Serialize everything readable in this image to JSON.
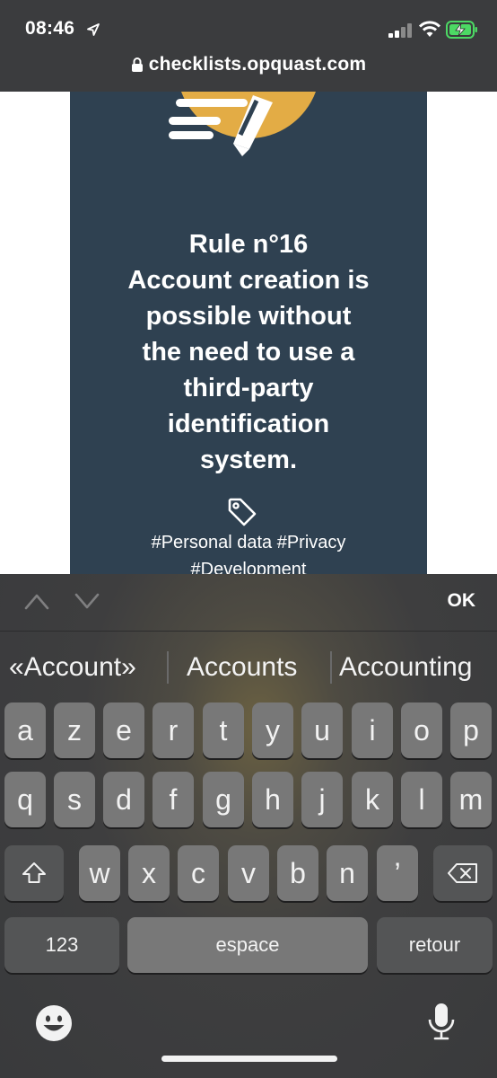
{
  "status": {
    "time": "08:46",
    "battery_state": "charging",
    "battery_color": "#4cd964"
  },
  "browser": {
    "url": "checklists.opquast.com"
  },
  "card": {
    "background": "#2f4151",
    "logo_color": "#e3ac45",
    "title_lines": [
      "Rule n°16",
      "Account creation is",
      "possible without",
      "the need to use a",
      "third-party",
      "identification",
      "system."
    ],
    "tags_lines": [
      "#Personal data #Privacy",
      "#Development"
    ]
  },
  "keyboard": {
    "ok_label": "OK",
    "suggestions": [
      "«Account»",
      "Accounts",
      "Accounting"
    ],
    "rows": [
      [
        "a",
        "z",
        "e",
        "r",
        "t",
        "y",
        "u",
        "i",
        "o",
        "p"
      ],
      [
        "q",
        "s",
        "d",
        "f",
        "g",
        "h",
        "j",
        "k",
        "l",
        "m"
      ],
      [
        "w",
        "x",
        "c",
        "v",
        "b",
        "n",
        "’"
      ]
    ],
    "numbers_label": "123",
    "space_label": "espace",
    "return_label": "retour"
  }
}
